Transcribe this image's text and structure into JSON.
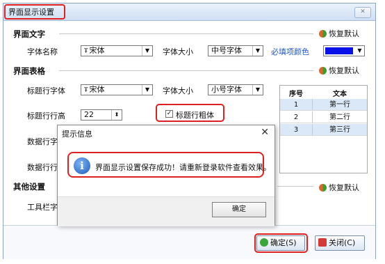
{
  "window": {
    "title": "界面显示设置",
    "close_symbol": "✕"
  },
  "sections": {
    "text": {
      "title": "界面文字",
      "restore": "恢复默认"
    },
    "table": {
      "title": "界面表格",
      "restore": "恢复默认"
    },
    "other": {
      "title": "其他设置",
      "restore": "恢复默认"
    }
  },
  "text_fields": {
    "font_name_label": "字体名称",
    "font_name_value": "宋体",
    "font_size_label": "字体大小",
    "font_size_value": "中号字体",
    "required_color_label": "必填项颜色",
    "required_color": "#0a10e8"
  },
  "table_fields": {
    "header_font_label": "标题行字体",
    "header_font_value": "宋体",
    "font_size_label": "字体大小",
    "font_size_value": "小号字体",
    "header_height_label": "标题行行高",
    "header_height_value": "22",
    "bold_label": "标题行粗体",
    "bold_checked": true,
    "data_font_label_partial": "数据行字",
    "data_height_label_partial": "数据行行"
  },
  "other_fields": {
    "toolbar_label_partial": "工具栏字"
  },
  "preview_table": {
    "headers": [
      "序号",
      "文本"
    ],
    "rows": [
      {
        "no": "1",
        "text": "第一行"
      },
      {
        "no": "2",
        "text": "第二行"
      },
      {
        "no": "3",
        "text": "第三行"
      }
    ]
  },
  "dialog": {
    "title": "提示信息",
    "close_symbol": "✕",
    "message": "界面显示设置保存成功！请重新登录软件查看效果。",
    "ok_label": "确定"
  },
  "buttons": {
    "ok_label": "确定(S)",
    "close_label": "关闭(C)"
  },
  "colors": {
    "highlight": "#e02020",
    "link": "#1f56c9",
    "swatch": "#0a10e8"
  }
}
